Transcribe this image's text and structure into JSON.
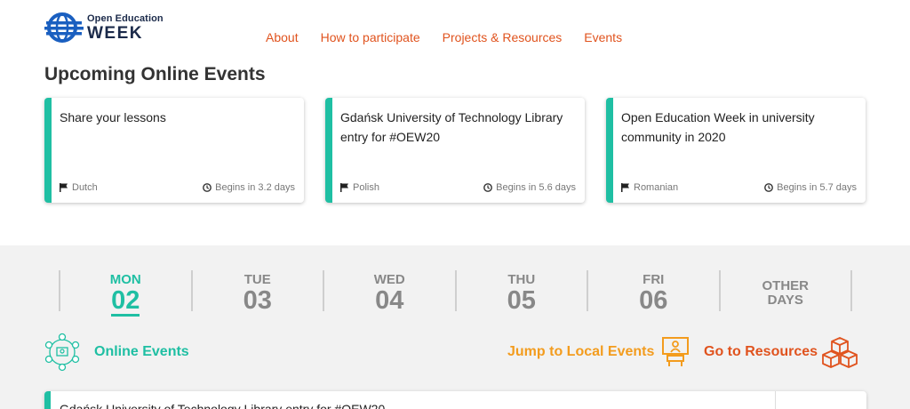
{
  "logo": {
    "top": "Open Education",
    "bottom": "WEEK",
    "icon": "globe-logo-icon"
  },
  "nav": [
    "About",
    "How to participate",
    "Projects & Resources",
    "Events"
  ],
  "upcoming": {
    "title": "Upcoming Online Events",
    "cards": [
      {
        "title": "Share your lessons",
        "language": "Dutch",
        "begins": "Begins in 3.2 days"
      },
      {
        "title": "Gdańsk University of Technology Library entry for #OEW20",
        "language": "Polish",
        "begins": "Begins in 5.6 days"
      },
      {
        "title": "Open Education Week in university community in 2020",
        "language": "Romanian",
        "begins": "Begins in 5.7 days"
      }
    ]
  },
  "days": [
    {
      "name": "MON",
      "num": "02",
      "active": true
    },
    {
      "name": "TUE",
      "num": "03"
    },
    {
      "name": "WED",
      "num": "04"
    },
    {
      "name": "THU",
      "num": "05"
    },
    {
      "name": "FRI",
      "num": "06"
    }
  ],
  "other_days": {
    "line1": "OTHER",
    "line2": "DAYS"
  },
  "online_events_label": "Online Events",
  "jump_label": "Jump to Local Events",
  "resources_label": "Go to Resources",
  "list_card_title": "Gdańsk University of Technology Library entry for #OEW20",
  "colors": {
    "accent": "#1fbfa3",
    "link": "#e0531e",
    "orange": "#f39c1e"
  }
}
